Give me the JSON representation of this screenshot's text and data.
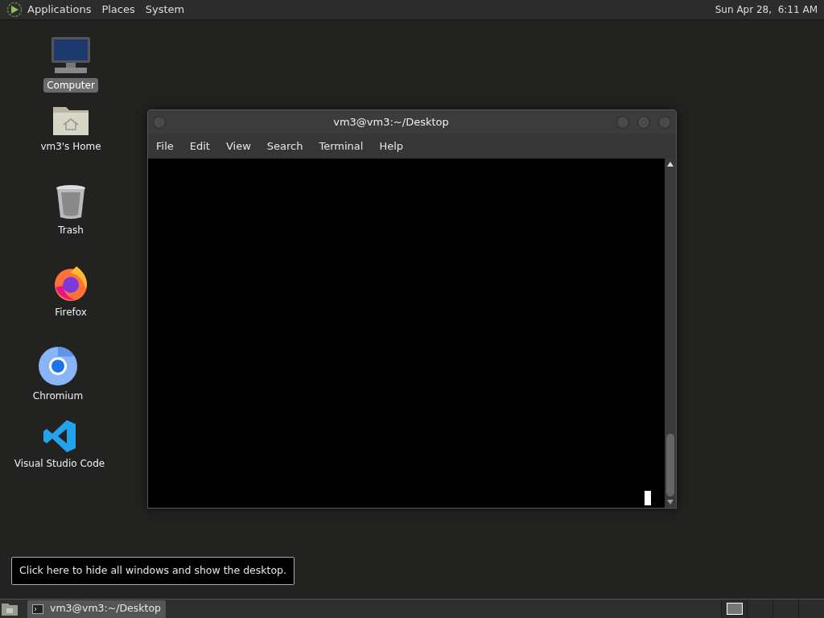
{
  "top_panel": {
    "menus": [
      "Applications",
      "Places",
      "System"
    ],
    "clock": "Sun Apr 28,  6:11 AM"
  },
  "desktop_icons": [
    {
      "label": "Computer",
      "kind": "computer",
      "selected": true
    },
    {
      "label": "vm3's Home",
      "kind": "home",
      "selected": false
    },
    {
      "label": "Trash",
      "kind": "trash",
      "selected": false
    },
    {
      "label": "Firefox",
      "kind": "firefox",
      "selected": false
    },
    {
      "label": "Chromium",
      "kind": "chromium",
      "selected": false
    },
    {
      "label": "Visual Studio Code",
      "kind": "vscode",
      "selected": false
    }
  ],
  "window": {
    "title": "vm3@vm3:~/Desktop",
    "menus": [
      "File",
      "Edit",
      "View",
      "Search",
      "Terminal",
      "Help"
    ]
  },
  "tooltip": "Click here to hide all windows and show the desktop.",
  "taskbar": {
    "tasks": [
      {
        "label": "vm3@vm3:~/Desktop",
        "selected": true
      }
    ],
    "workspaces": [
      {
        "selected": true
      },
      {
        "selected": false
      },
      {
        "selected": false
      },
      {
        "selected": false
      }
    ]
  }
}
